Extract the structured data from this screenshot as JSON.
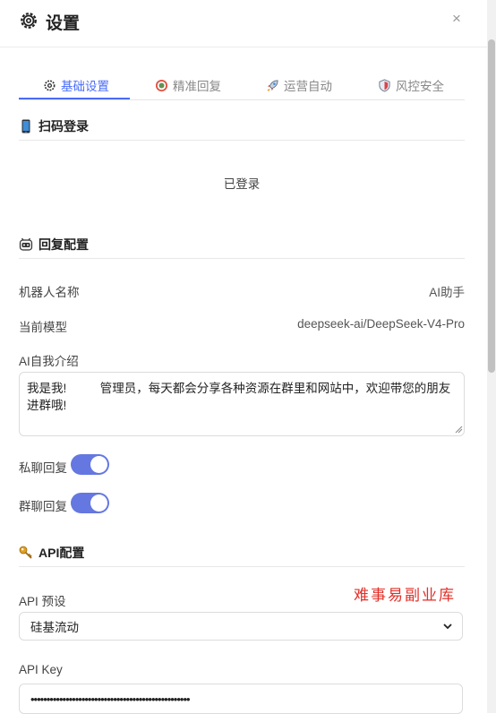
{
  "header": {
    "title": "设置",
    "close_label": "×"
  },
  "tabs": [
    {
      "label": "基础设置",
      "active": true
    },
    {
      "label": "精准回复",
      "active": false
    },
    {
      "label": "运营自动",
      "active": false
    },
    {
      "label": "风控安全",
      "active": false
    }
  ],
  "scan_login": {
    "title": "扫码登录",
    "status": "已登录"
  },
  "reply_config": {
    "title": "回复配置",
    "bot_name_label": "机器人名称",
    "bot_name_value": "AI助手",
    "model_label": "当前模型",
    "model_value": "deepseek-ai/DeepSeek-V4-Pro",
    "intro_label": "AI自我介绍",
    "intro_value": "我是我!          管理员，每天都会分享各种资源在群里和网站中，欢迎带您的朋友进群哦!",
    "private_reply_label": "私聊回复",
    "private_reply_on": true,
    "group_reply_label": "群聊回复",
    "group_reply_on": true
  },
  "api_config": {
    "title": "API配置",
    "preset_label": "API 预设",
    "preset_value": "硅基流动",
    "key_label": "API Key",
    "key_value": "••••••••••••••••••••••••••••••••••••••••••••••••••"
  },
  "watermark": "难事易副业库",
  "colors": {
    "accent": "#4a6cf7",
    "toggle": "#6577e0",
    "watermark": "#e0302a"
  }
}
